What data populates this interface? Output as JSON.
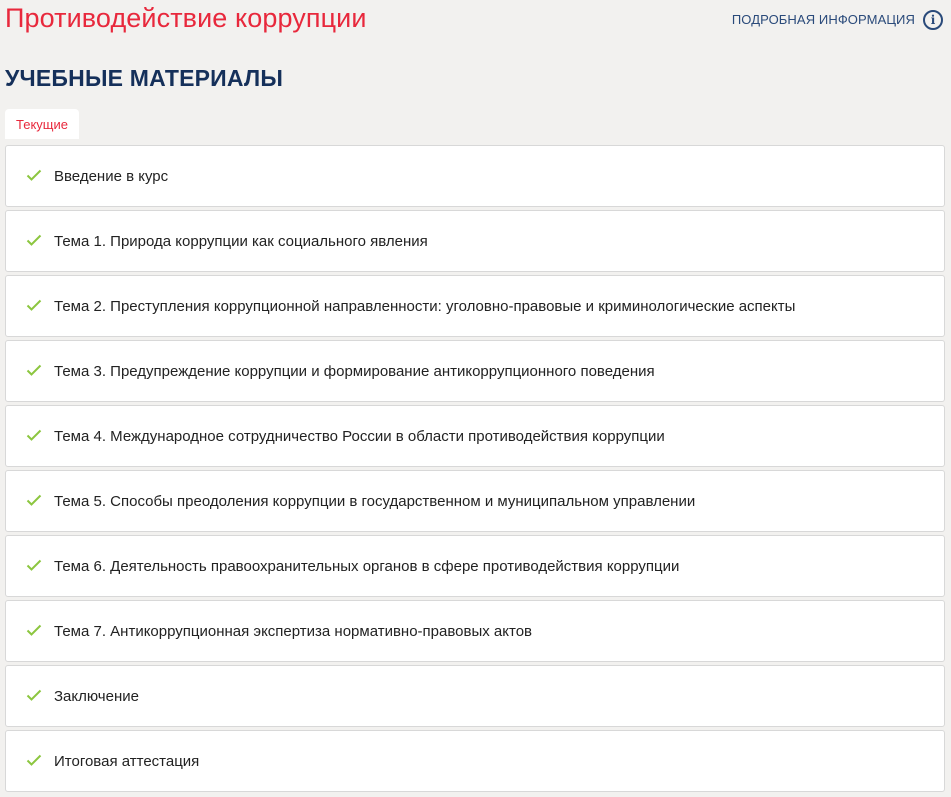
{
  "header": {
    "course_title": "Противодействие коррупции",
    "info_link_label": "ПОДРОБНАЯ ИНФОРМАЦИЯ",
    "info_icon": "info-circle-icon"
  },
  "section": {
    "title": "УЧЕБНЫЕ МАТЕРИАЛЫ"
  },
  "tabs": [
    {
      "label": "Текущие",
      "active": true
    }
  ],
  "colors": {
    "accent_red": "#e8283c",
    "heading_navy": "#15305a",
    "link_blue": "#2a4a7a",
    "check_green": "#8cc63f",
    "background": "#f2f1ef"
  },
  "materials": [
    {
      "label": "Введение в курс",
      "icon": "check-icon",
      "completed": true
    },
    {
      "label": "Тема 1. Природа коррупции как социального явления",
      "icon": "check-icon",
      "completed": true
    },
    {
      "label": "Тема 2. Преступления коррупционной направленности: уголовно-правовые и криминологические аспекты",
      "icon": "check-icon",
      "completed": true
    },
    {
      "label": "Тема 3. Предупреждение коррупции и формирование антикоррупционного поведения",
      "icon": "check-icon",
      "completed": true
    },
    {
      "label": "Тема 4. Международное сотрудничество России в области противодействия коррупции",
      "icon": "check-icon",
      "completed": true
    },
    {
      "label": "Тема 5. Способы преодоления коррупции в государственном и муниципальном управлении",
      "icon": "check-icon",
      "completed": true
    },
    {
      "label": "Тема 6. Деятельность правоохранительных органов в сфере противодействия коррупции",
      "icon": "check-icon",
      "completed": true
    },
    {
      "label": "Тема 7. Антикоррупционная экспертиза нормативно-правовых актов",
      "icon": "check-icon",
      "completed": true
    },
    {
      "label": "Заключение",
      "icon": "check-icon",
      "completed": true
    },
    {
      "label": "Итоговая аттестация",
      "icon": "check-icon",
      "completed": true
    }
  ]
}
